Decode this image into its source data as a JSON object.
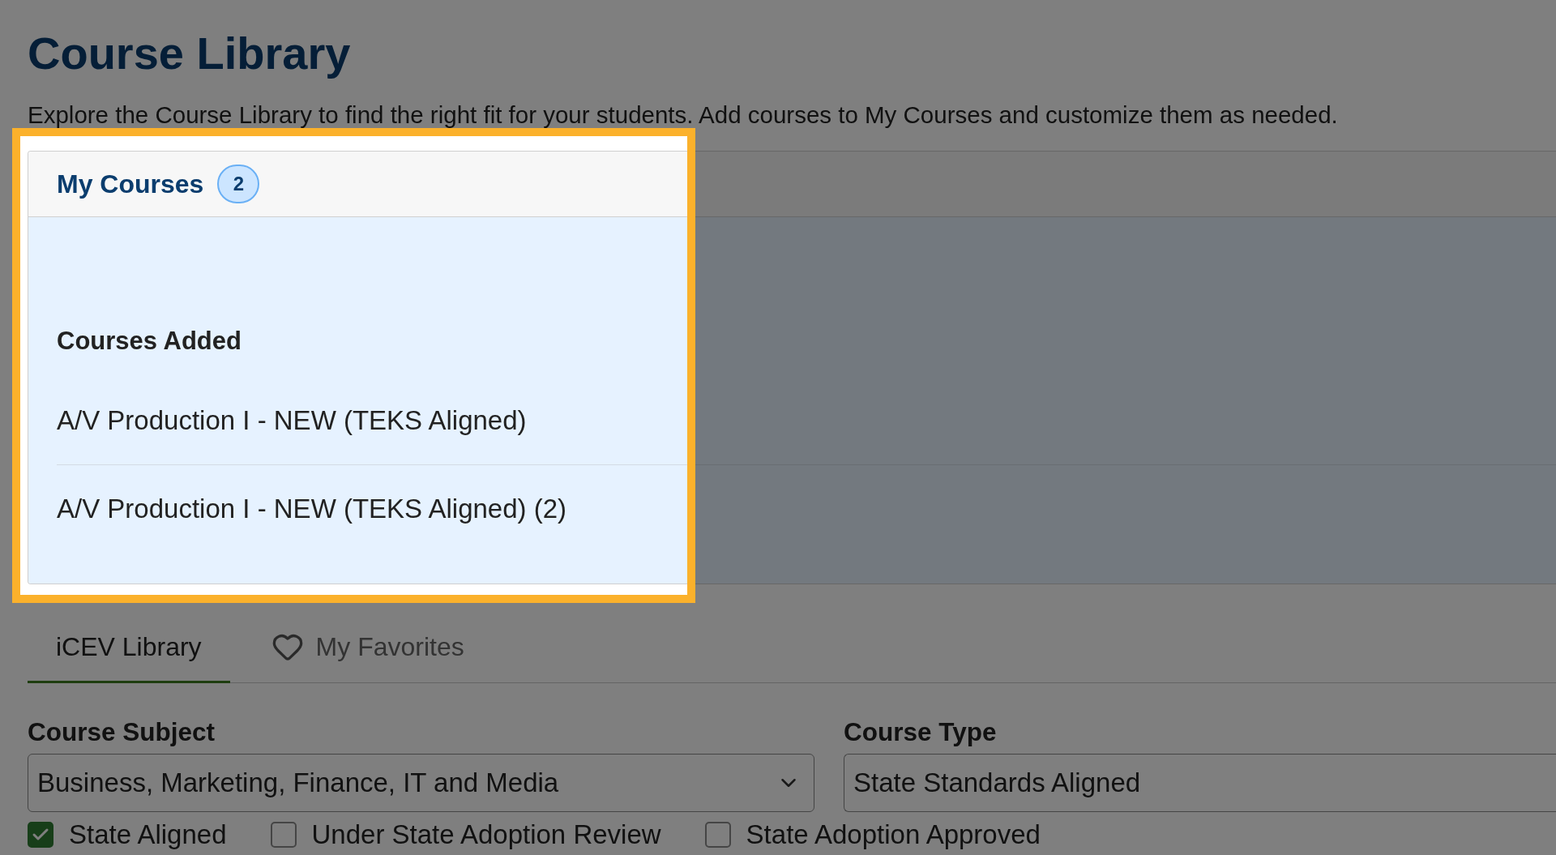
{
  "page": {
    "title": "Course Library",
    "description": "Explore the Course Library to find the right fit for your students. Add courses to My Courses and customize them as needed."
  },
  "my_courses": {
    "title": "My Courses",
    "count": "2",
    "highlighted": true,
    "section_title": "Courses Added",
    "courses": [
      "A/V Production I - NEW (TEKS Aligned)",
      "A/V Production I - NEW (TEKS Aligned) (2)"
    ]
  },
  "tabs": [
    {
      "label": "iCEV Library",
      "selected": true,
      "kind": "plain"
    },
    {
      "label": "My Favorites",
      "selected": false,
      "kind": "favorites"
    }
  ],
  "filters": [
    {
      "label": "Course Subject",
      "value": "Business, Marketing, Finance, IT and Media",
      "kind": "dropdown"
    },
    {
      "label": "Course Type",
      "value": "State Standards Aligned",
      "kind": "field"
    }
  ],
  "checkboxes": [
    {
      "label": "State Aligned",
      "checked": true
    },
    {
      "label": "Under State Adoption Review",
      "checked": false
    },
    {
      "label": "State Adoption Approved",
      "checked": false
    }
  ]
}
